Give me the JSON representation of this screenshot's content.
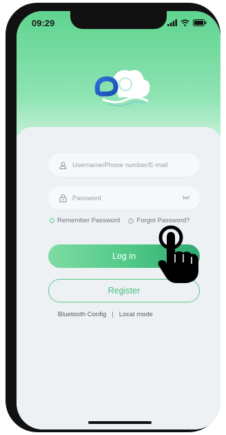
{
  "status_bar": {
    "time": "09:29"
  },
  "login_form": {
    "username_placeholder": "Username/Phone number/E-mail",
    "password_placeholder": "Password",
    "remember_label": "Remember Password",
    "forgot_label": "Forgot Password?",
    "login_label": "Log in",
    "register_label": "Register",
    "bluetooth_label": "Bluetooth Config",
    "separator": "|",
    "local_label": "Local mode"
  },
  "icons": {
    "logo": "cloud-logo-icon",
    "user": "user-icon",
    "lock": "lock-icon",
    "eye": "eye-closed-icon",
    "help": "help-circle-icon",
    "hand": "pointing-hand-icon"
  },
  "colors": {
    "accent": "#4fc886",
    "accent_dark": "#2faa70",
    "hero_top": "#5fd38f",
    "background": "#eef1f4"
  }
}
